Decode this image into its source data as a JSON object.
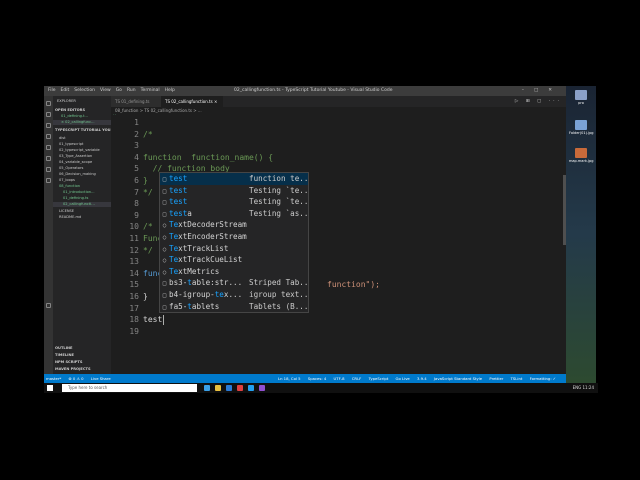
{
  "window": {
    "menu": [
      "File",
      "Edit",
      "Selection",
      "View",
      "Go",
      "Run",
      "Terminal",
      "Help"
    ],
    "title": "02_callingfunction.ts - TypeScript Tutorial Youtube - Visual Studio Code"
  },
  "sidebar": {
    "explorer": "EXPLORER",
    "open_editors": "OPEN EDITORS",
    "open_files": [
      "01_defining.t...",
      "× 02_callingfunc..."
    ],
    "project": "TYPESCRIPT TUTORIAL YOU...",
    "items": [
      "dist",
      "01_typescript",
      "02_typescript_variable",
      "03_Type_Assertion",
      "04_variable_scope",
      "05_Operators",
      "06_Decision_making",
      "07_loops",
      "08_function",
      "01_introduction...",
      "01_defining.ts",
      "02_callingfuncti...",
      "LICENSE",
      "README.md"
    ],
    "sections": [
      "OUTLINE",
      "TIMELINE",
      "NPM SCRIPTS",
      "MAVEN PROJECTS"
    ],
    "badge": "U"
  },
  "tabs": [
    {
      "label": "TS 01_defining.ts"
    },
    {
      "label": "TS 02_callingfunction.ts ×"
    }
  ],
  "breadcrumb": "08_function > TS 02_callingfunction.ts > ...",
  "editor": {
    "line_numbers": [
      "1",
      "2",
      "3",
      "4",
      "5",
      "6",
      "7",
      "8",
      "9",
      "10",
      "11",
      "12",
      "13",
      "14",
      "15",
      "16",
      "17",
      "18",
      "19"
    ],
    "lines": {
      "l2": "/*",
      "l4a": "function",
      "l4b": "  function_name() {",
      "l5": "  // function body",
      "l6": "}",
      "l7": "*/",
      "l9": "/*",
      "l10": "Func",
      "l11": "*/",
      "l13": "func",
      "l14": "",
      "l15a": "   ",
      "l15b": "function\");",
      "l16": "}",
      "l18": "test"
    }
  },
  "suggest": [
    {
      "kind": "□",
      "pre": "",
      "hl": "test",
      "post": "",
      "detail": "function te..."
    },
    {
      "kind": "□",
      "pre": "",
      "hl": "test",
      "post": "",
      "detail": "Testing `te..."
    },
    {
      "kind": "□",
      "pre": "",
      "hl": "test",
      "post": "",
      "detail": "Testing `te..."
    },
    {
      "kind": "□",
      "pre": "",
      "hl": "test",
      "post": "a",
      "detail": "Testing `as..."
    },
    {
      "kind": "○",
      "pre": "",
      "hl": "Te",
      "post": "xtDecoderStream",
      "detail": ""
    },
    {
      "kind": "○",
      "pre": "",
      "hl": "Te",
      "post": "xtEncoderStream",
      "detail": ""
    },
    {
      "kind": "○",
      "pre": "",
      "hl": "Te",
      "post": "xtTrackList",
      "detail": ""
    },
    {
      "kind": "○",
      "pre": "",
      "hl": "Te",
      "post": "xtTrackCueList",
      "detail": ""
    },
    {
      "kind": "○",
      "pre": "",
      "hl": "Te",
      "post": "xtMetrics",
      "detail": ""
    },
    {
      "kind": "□",
      "pre": "bs3-",
      "hl": "t",
      "post": "able:str...",
      "detail": "Striped Tab..."
    },
    {
      "kind": "□",
      "pre": "b4-igroup-",
      "hl": "te",
      "post": "x...",
      "detail": "igroup text..."
    },
    {
      "kind": "□",
      "pre": "fa5-",
      "hl": "t",
      "post": "ablets",
      "detail": "Tablets (B..."
    }
  ],
  "status": {
    "left": [
      "master*",
      "⊗ 0 ⚠ 0",
      "Live Share"
    ],
    "right": [
      "Ln 18, Col 5",
      "Spaces: 4",
      "UTF-8",
      "CRLF",
      "TypeScript",
      "Go Live",
      "3.9.4",
      "JavaScript Standard Style",
      "Prettier",
      "TSLint",
      "Formatting: ✓"
    ]
  },
  "desktop": {
    "icons": [
      "pro",
      "Folder(01).jpg",
      "map.mark.jpg"
    ]
  },
  "taskbar": {
    "search": "Type here to search",
    "tray": "ENG 11:24"
  }
}
